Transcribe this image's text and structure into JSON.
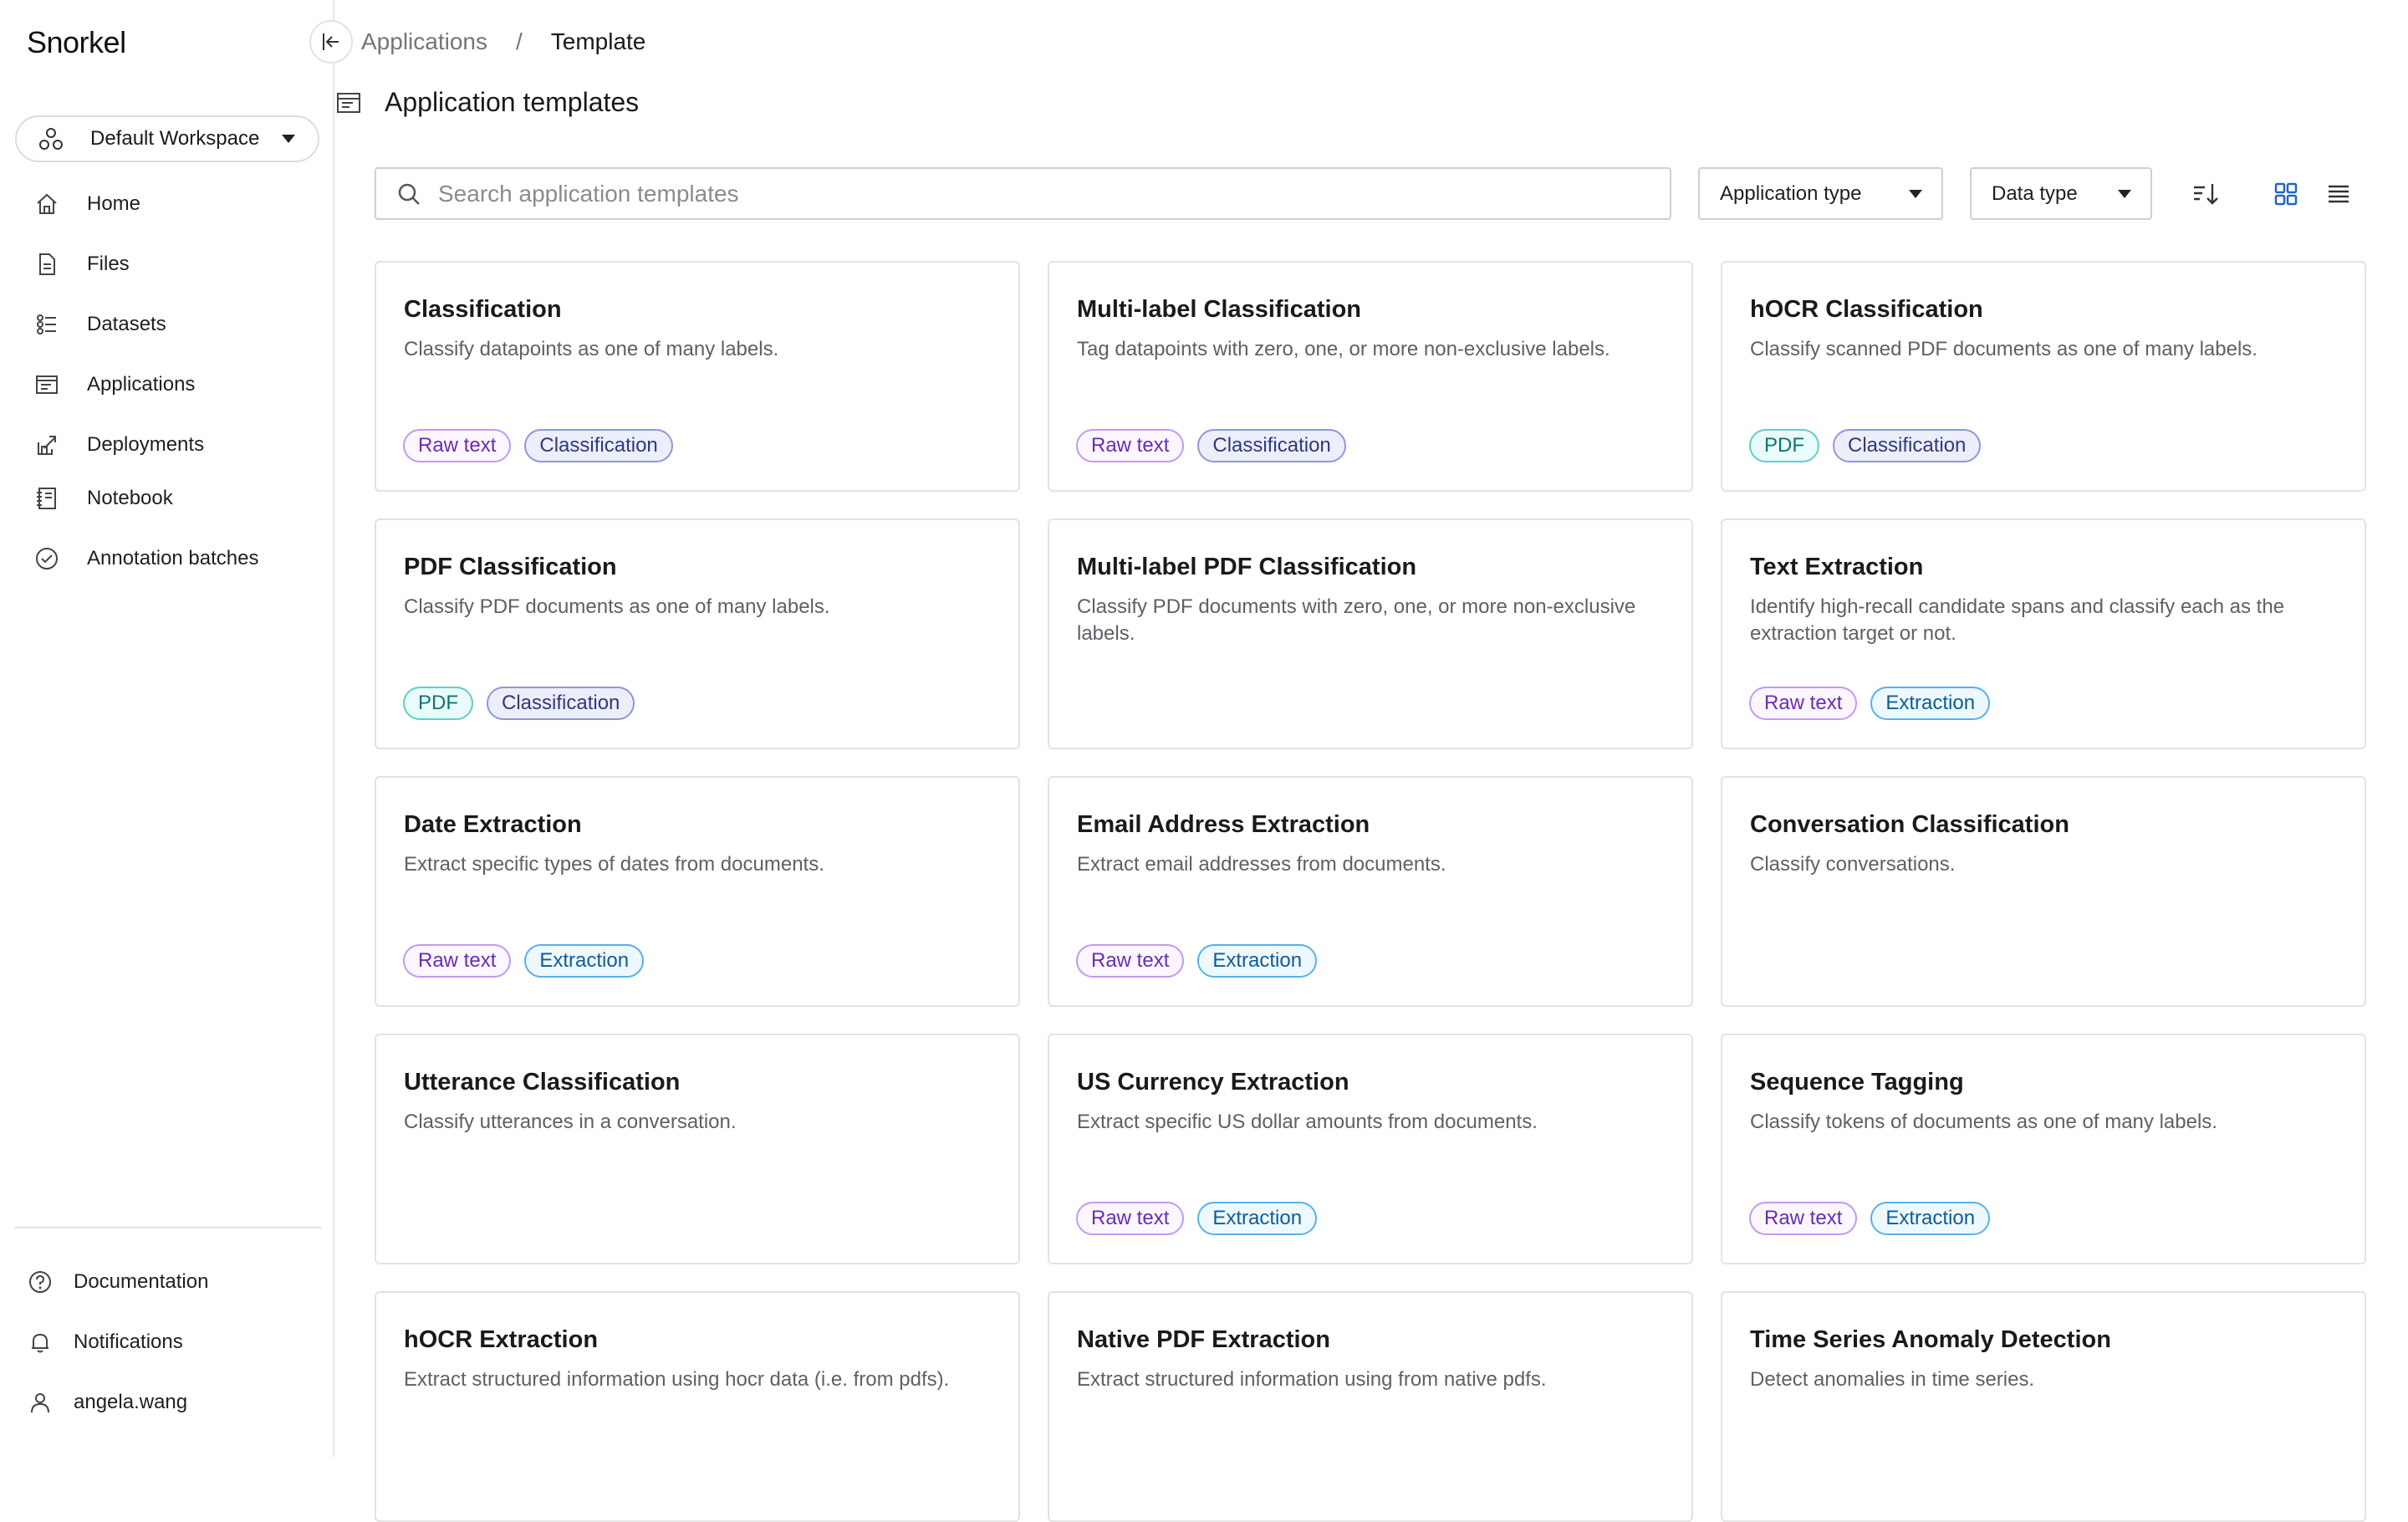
{
  "app": {
    "logo_text": "Snorkel"
  },
  "sidebar": {
    "workspace": "Default Workspace",
    "items": [
      {
        "label": "Home",
        "icon": "home-icon"
      },
      {
        "label": "Files",
        "icon": "file-icon"
      },
      {
        "label": "Datasets",
        "icon": "datasets-icon"
      },
      {
        "label": "Applications",
        "icon": "applications-icon"
      },
      {
        "label": "Deployments",
        "icon": "deployments-icon"
      },
      {
        "label": "Notebook",
        "icon": "notebook-icon"
      },
      {
        "label": "Annotation batches",
        "icon": "check-circle-icon"
      }
    ],
    "footer": [
      {
        "label": "Documentation",
        "icon": "help-icon"
      },
      {
        "label": "Notifications",
        "icon": "bell-icon"
      },
      {
        "label": "angela.wang",
        "icon": "user-icon"
      }
    ]
  },
  "header": {
    "breadcrumb": {
      "parent": "Applications",
      "separator": "/",
      "current": "Template"
    },
    "title": "Application templates"
  },
  "toolbar": {
    "search_placeholder": "Search application templates",
    "search_value": "",
    "application_type_label": "Application type",
    "data_type_label": "Data type"
  },
  "colors": {
    "raw_text_tag": "#6b2bb5",
    "classification_tag": "#2f3a7a",
    "pdf_tag": "#0d7471",
    "extraction_tag": "#0e5d94",
    "active_view": "#2563c9"
  },
  "cards": [
    {
      "title": "Classification",
      "description": "Classify datapoints as one of many labels.",
      "tags": [
        [
          "Raw text",
          "raw"
        ],
        [
          "Classification",
          "cls"
        ]
      ]
    },
    {
      "title": "Multi-label Classification",
      "description": "Tag datapoints with zero, one, or more non-exclusive labels.",
      "tags": [
        [
          "Raw text",
          "raw"
        ],
        [
          "Classification",
          "cls"
        ]
      ]
    },
    {
      "title": "hOCR Classification",
      "description": "Classify scanned PDF documents as one of many labels.",
      "tags": [
        [
          "PDF",
          "pdf"
        ],
        [
          "Classification",
          "cls"
        ]
      ]
    },
    {
      "title": "PDF Classification",
      "description": "Classify PDF documents as one of many labels.",
      "tags": [
        [
          "PDF",
          "pdf"
        ],
        [
          "Classification",
          "cls"
        ]
      ]
    },
    {
      "title": "Multi-label PDF Classification",
      "description": "Classify PDF documents with zero, one, or more non-exclusive labels.",
      "tags": []
    },
    {
      "title": "Text Extraction",
      "description": "Identify high-recall candidate spans and classify each as the extraction target or not.",
      "tags": [
        [
          "Raw text",
          "raw"
        ],
        [
          "Extraction",
          "ext"
        ]
      ]
    },
    {
      "title": "Date Extraction",
      "description": "Extract specific types of dates from documents.",
      "tags": [
        [
          "Raw text",
          "raw"
        ],
        [
          "Extraction",
          "ext"
        ]
      ]
    },
    {
      "title": "Email Address Extraction",
      "description": "Extract email addresses from documents.",
      "tags": [
        [
          "Raw text",
          "raw"
        ],
        [
          "Extraction",
          "ext"
        ]
      ]
    },
    {
      "title": "Conversation Classification",
      "description": "Classify conversations.",
      "tags": []
    },
    {
      "title": "Utterance Classification",
      "description": "Classify utterances in a conversation.",
      "tags": []
    },
    {
      "title": "US Currency Extraction",
      "description": "Extract specific US dollar amounts from documents.",
      "tags": [
        [
          "Raw text",
          "raw"
        ],
        [
          "Extraction",
          "ext"
        ]
      ]
    },
    {
      "title": "Sequence Tagging",
      "description": "Classify tokens of documents as one of many labels.",
      "tags": [
        [
          "Raw text",
          "raw"
        ],
        [
          "Extraction",
          "ext"
        ]
      ]
    },
    {
      "title": "hOCR Extraction",
      "description": "Extract structured information using hocr data (i.e. from pdfs).",
      "tags": []
    },
    {
      "title": "Native PDF Extraction",
      "description": "Extract structured information using from native pdfs.",
      "tags": []
    },
    {
      "title": "Time Series Anomaly Detection",
      "description": "Detect anomalies in time series.",
      "tags": []
    }
  ]
}
